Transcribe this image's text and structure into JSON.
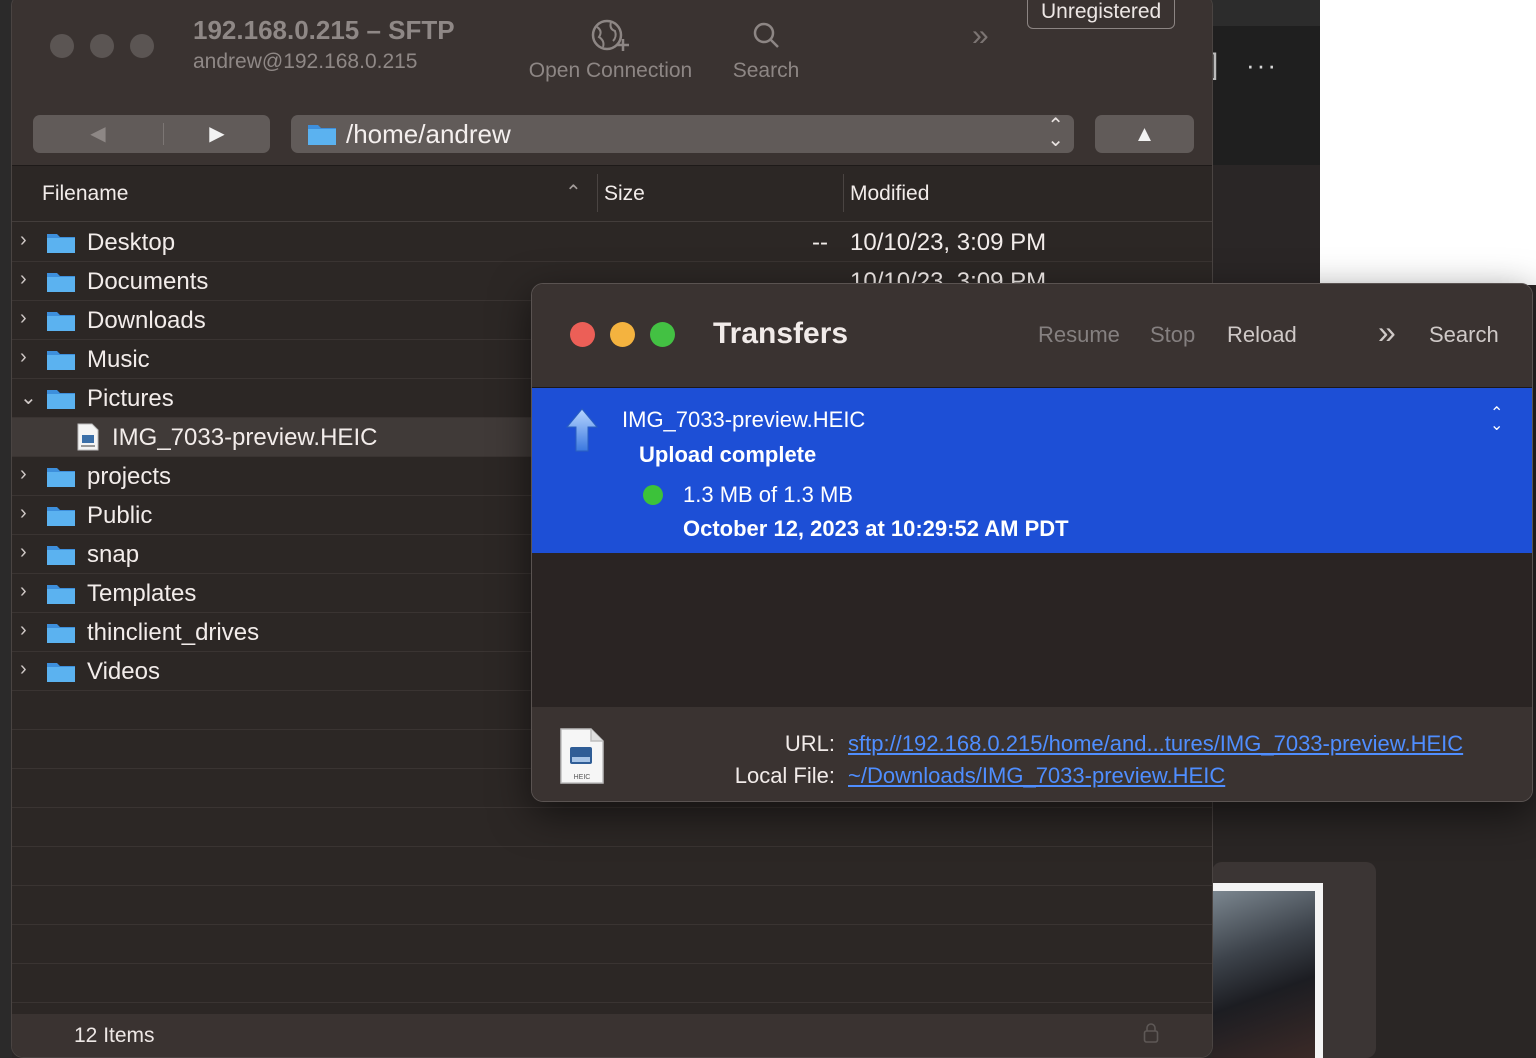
{
  "sftp_window": {
    "title": "192.168.0.215 – SFTP",
    "subtitle": "andrew@192.168.0.215",
    "toolbar": {
      "open_connection_label": "Open Connection",
      "search_label": "Search",
      "more_icon": "chevron-double-right-icon"
    },
    "unregistered_label": "Unregistered",
    "nav": {
      "back_glyph": "◀",
      "forward_glyph": "▶",
      "path": "/home/andrew",
      "up_glyph": "▲"
    },
    "columns": {
      "filename": "Filename",
      "size": "Size",
      "modified": "Modified"
    },
    "rows": [
      {
        "name": "Desktop",
        "size": "--",
        "modified": "10/10/23, 3:09 PM"
      },
      {
        "name": "Documents",
        "size": "",
        "modified": "10/10/23, 3:09 PM"
      },
      {
        "name": "Downloads"
      },
      {
        "name": "Music"
      },
      {
        "name": "Pictures"
      },
      {
        "name": "IMG_7033-preview.HEIC"
      },
      {
        "name": "projects"
      },
      {
        "name": "Public"
      },
      {
        "name": "snap"
      },
      {
        "name": "Templates"
      },
      {
        "name": "thinclient_drives"
      },
      {
        "name": "Videos"
      }
    ],
    "status": {
      "item_count": "12 Items"
    }
  },
  "transfers_window": {
    "title": "Transfers",
    "toolbar": {
      "resume_label": "Resume",
      "stop_label": "Stop",
      "reload_label": "Reload",
      "search_label": "Search"
    },
    "transfer": {
      "filename": "IMG_7033-preview.HEIC",
      "status": "Upload complete",
      "progress": "1.3 MB of 1.3 MB",
      "progress_fraction": 1.0,
      "timestamp": "October 12, 2023 at 10:29:52 AM PDT"
    },
    "info": {
      "url_label": "URL:",
      "url_value": "sftp://192.168.0.215/home/and...tures/IMG_7033-preview.HEIC",
      "local_label": "Local File:",
      "local_value": "~/Downloads/IMG_7033-preview.HEIC",
      "file_type": "HEIC"
    }
  },
  "colors": {
    "selection_blue": "#1d4fd6",
    "folder_blue": "#4aa3ea",
    "traffic_red": "#ec5f57",
    "traffic_yellow": "#f4b33f",
    "traffic_green": "#43c143",
    "link_blue": "#4f8eff",
    "status_green": "#3cc23a"
  }
}
